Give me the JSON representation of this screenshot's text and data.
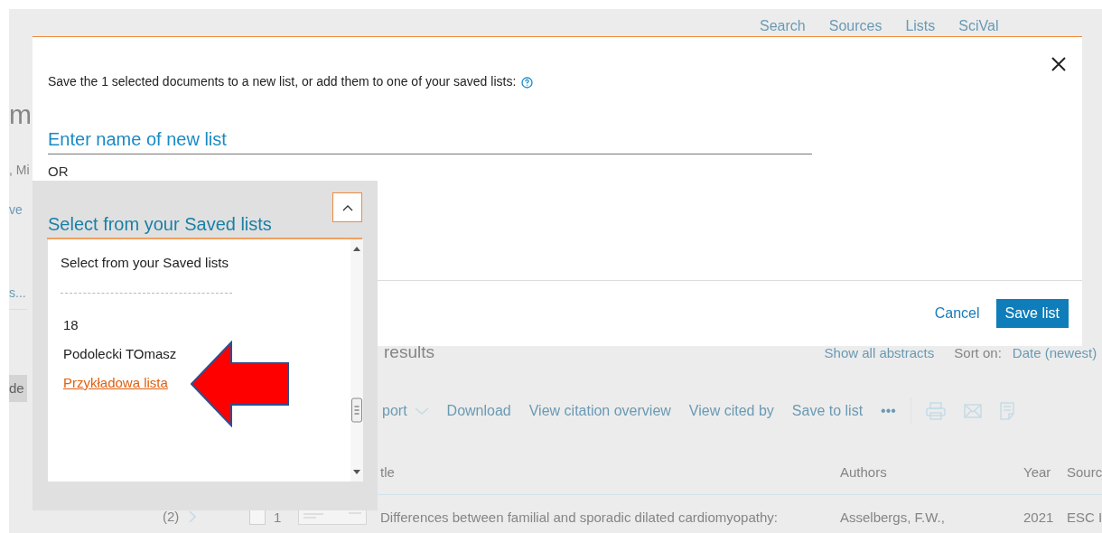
{
  "background_page": {
    "nav": [
      "Search",
      "Sources",
      "Lists",
      "SciVal"
    ],
    "left_fragments": {
      "heading": "m",
      "authors": ", Mi",
      "link": "ve",
      "link_2": "s...",
      "button": "de",
      "pager": "(2)"
    },
    "results_label": "results",
    "show_all_abstracts": "Show all abstracts",
    "sort_label": "Sort on:",
    "sort_value": "Date (newest)",
    "toolbar": [
      {
        "kind": "dropdown",
        "label": "port"
      },
      {
        "kind": "link",
        "label": "Download"
      },
      {
        "kind": "link",
        "label": "View citation overview"
      },
      {
        "kind": "link",
        "label": "View cited by"
      },
      {
        "kind": "link",
        "label": "Save to list"
      },
      {
        "kind": "more",
        "label": "•••"
      }
    ],
    "table": {
      "columns": [
        "tle",
        "Authors",
        "Year",
        "Sourc"
      ],
      "rows": [
        {
          "number": "1",
          "title": "Differences between familial and sporadic dilated cardiomyopathy:",
          "authors": "Asselbergs, F.W.,",
          "year": "2021",
          "source": "ESC I",
          "checked": false
        }
      ]
    }
  },
  "modal": {
    "message": "Save the 1 selected documents to a new list, or add them to one of your saved lists:",
    "name_field": {
      "placeholder": "Enter name of new list"
    },
    "or_label": "OR",
    "cancel": "Cancel",
    "save": "Save list"
  },
  "saved_lists_dropdown": {
    "label": "Select from your Saved lists",
    "expanded": true,
    "header": "Select from your Saved lists",
    "options": [
      {
        "label": "18",
        "selected": false
      },
      {
        "label": "Podolecki TOmasz",
        "selected": false
      },
      {
        "label": "Przykładowa lista",
        "selected": true
      }
    ]
  }
}
